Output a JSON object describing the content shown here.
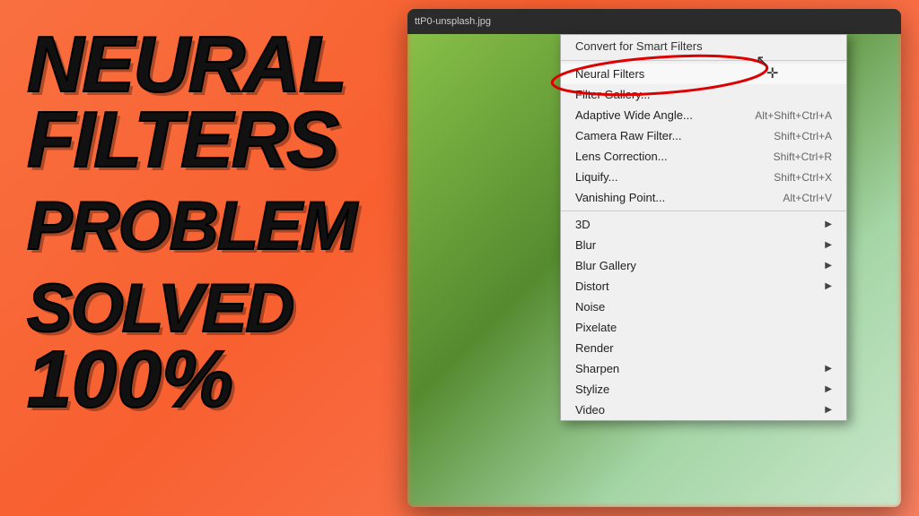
{
  "background": {
    "gradient_start": "#f97040",
    "gradient_end": "#fa8060"
  },
  "left_text": {
    "line1": "NEURAL",
    "line2": "FILTERS",
    "line3": "PROBLEM",
    "line4": "SOLVED",
    "line5": "100%"
  },
  "photoshop": {
    "filename": "ttP0-unsplash.jpg",
    "topbar_label": "ttP0-unsplash.jpg"
  },
  "context_menu": {
    "header_item": "Convert for Smart Filters",
    "items": [
      {
        "label": "Neural Filters",
        "shortcut": "",
        "has_arrow": false,
        "highlighted": true
      },
      {
        "label": "Filter Gallery...",
        "shortcut": "",
        "has_arrow": false
      },
      {
        "label": "Adaptive Wide Angle...",
        "shortcut": "Alt+Shift+Ctrl+A",
        "has_arrow": false
      },
      {
        "label": "Camera Raw Filter...",
        "shortcut": "Shift+Ctrl+A",
        "has_arrow": false
      },
      {
        "label": "Lens Correction...",
        "shortcut": "Shift+Ctrl+R",
        "has_arrow": false
      },
      {
        "label": "Liquify...",
        "shortcut": "Shift+Ctrl+X",
        "has_arrow": false
      },
      {
        "label": "Vanishing Point...",
        "shortcut": "Alt+Ctrl+V",
        "has_arrow": false
      }
    ],
    "sub_items": [
      {
        "label": "3D",
        "has_arrow": true
      },
      {
        "label": "Blur",
        "has_arrow": true
      },
      {
        "label": "Blur Gallery",
        "has_arrow": true
      },
      {
        "label": "Distort",
        "has_arrow": true
      },
      {
        "label": "Noise",
        "has_arrow": false
      },
      {
        "label": "Pixelate",
        "has_arrow": false
      },
      {
        "label": "Render",
        "has_arrow": false
      },
      {
        "label": "Sharpen",
        "has_arrow": true
      },
      {
        "label": "Stylize",
        "has_arrow": true
      },
      {
        "label": "Video",
        "has_arrow": true
      }
    ]
  }
}
